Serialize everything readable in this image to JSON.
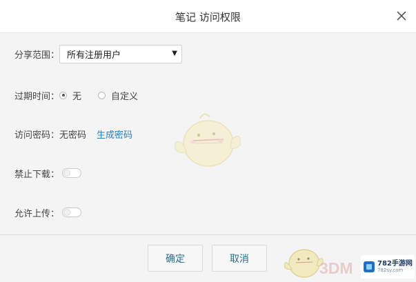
{
  "dialog": {
    "title": "笔记 访问权限"
  },
  "share_scope": {
    "label": "分享范围：",
    "selected": "所有注册用户"
  },
  "expiry": {
    "label": "过期时间：",
    "options": [
      {
        "label": "无",
        "checked": true
      },
      {
        "label": "自定义",
        "checked": false
      }
    ]
  },
  "password": {
    "label": "访问密码：",
    "value": "无密码",
    "generate_link": "生成密码"
  },
  "disable_download": {
    "label": "禁止下载：",
    "on": false
  },
  "allow_upload": {
    "label": "允许上传：",
    "on": false
  },
  "footer": {
    "ok_label": "确定",
    "cancel_label": "取消"
  },
  "watermark": {
    "text": "3DM",
    "badge_main": "782手游网",
    "badge_sub": "782sy.com"
  },
  "colors": {
    "link": "#2d7fb8",
    "button_text": "#2a6d8f",
    "background": "#f4f4f4"
  },
  "icons": [
    "close-icon",
    "dropdown-arrow-icon",
    "mascot-watermark",
    "site-logo-icon"
  ]
}
